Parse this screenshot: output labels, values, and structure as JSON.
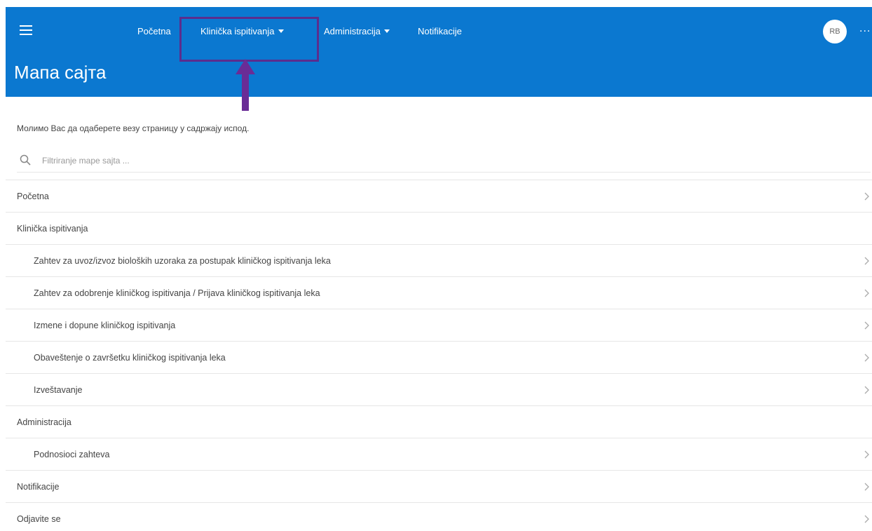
{
  "header": {
    "title": "Мапа сајта",
    "nav": [
      {
        "label": "Početna",
        "has_caret": false
      },
      {
        "label": "Klinička ispitivanja",
        "has_caret": true
      },
      {
        "label": "Administracija",
        "has_caret": true
      },
      {
        "label": "Notifikacije",
        "has_caret": false
      }
    ],
    "avatar_initials": "RB",
    "more_label": "...",
    "background_color": "#0b78d0",
    "highlight_color": "#5b2d8e"
  },
  "page": {
    "instructions": "Молимо Вас да одаберете везу страницу у садржају испод.",
    "search_placeholder": "Filtriranje mape sajta ...",
    "sitemap": [
      {
        "label": "Početna",
        "level": 0,
        "link": true
      },
      {
        "label": "Klinička ispitivanja",
        "level": 0,
        "link": false
      },
      {
        "label": "Zahtev za uvoz/izvoz bioloških uzoraka za postupak kliničkog ispitivanja leka",
        "level": 1,
        "link": true
      },
      {
        "label": "Zahtev za odobrenje kliničkog ispitivanja / Prijava kliničkog ispitivanja leka",
        "level": 1,
        "link": true
      },
      {
        "label": "Izmene i dopune kliničkog ispitivanja",
        "level": 1,
        "link": true
      },
      {
        "label": "Obaveštenje o završetku kliničkog ispitivanja leka",
        "level": 1,
        "link": true
      },
      {
        "label": "Izveštavanje",
        "level": 1,
        "link": true
      },
      {
        "label": "Administracija",
        "level": 0,
        "link": false
      },
      {
        "label": "Podnosioci zahteva",
        "level": 1,
        "link": true
      },
      {
        "label": "Notifikacije",
        "level": 0,
        "link": true
      },
      {
        "label": "Odjavite se",
        "level": 0,
        "link": true
      }
    ]
  }
}
